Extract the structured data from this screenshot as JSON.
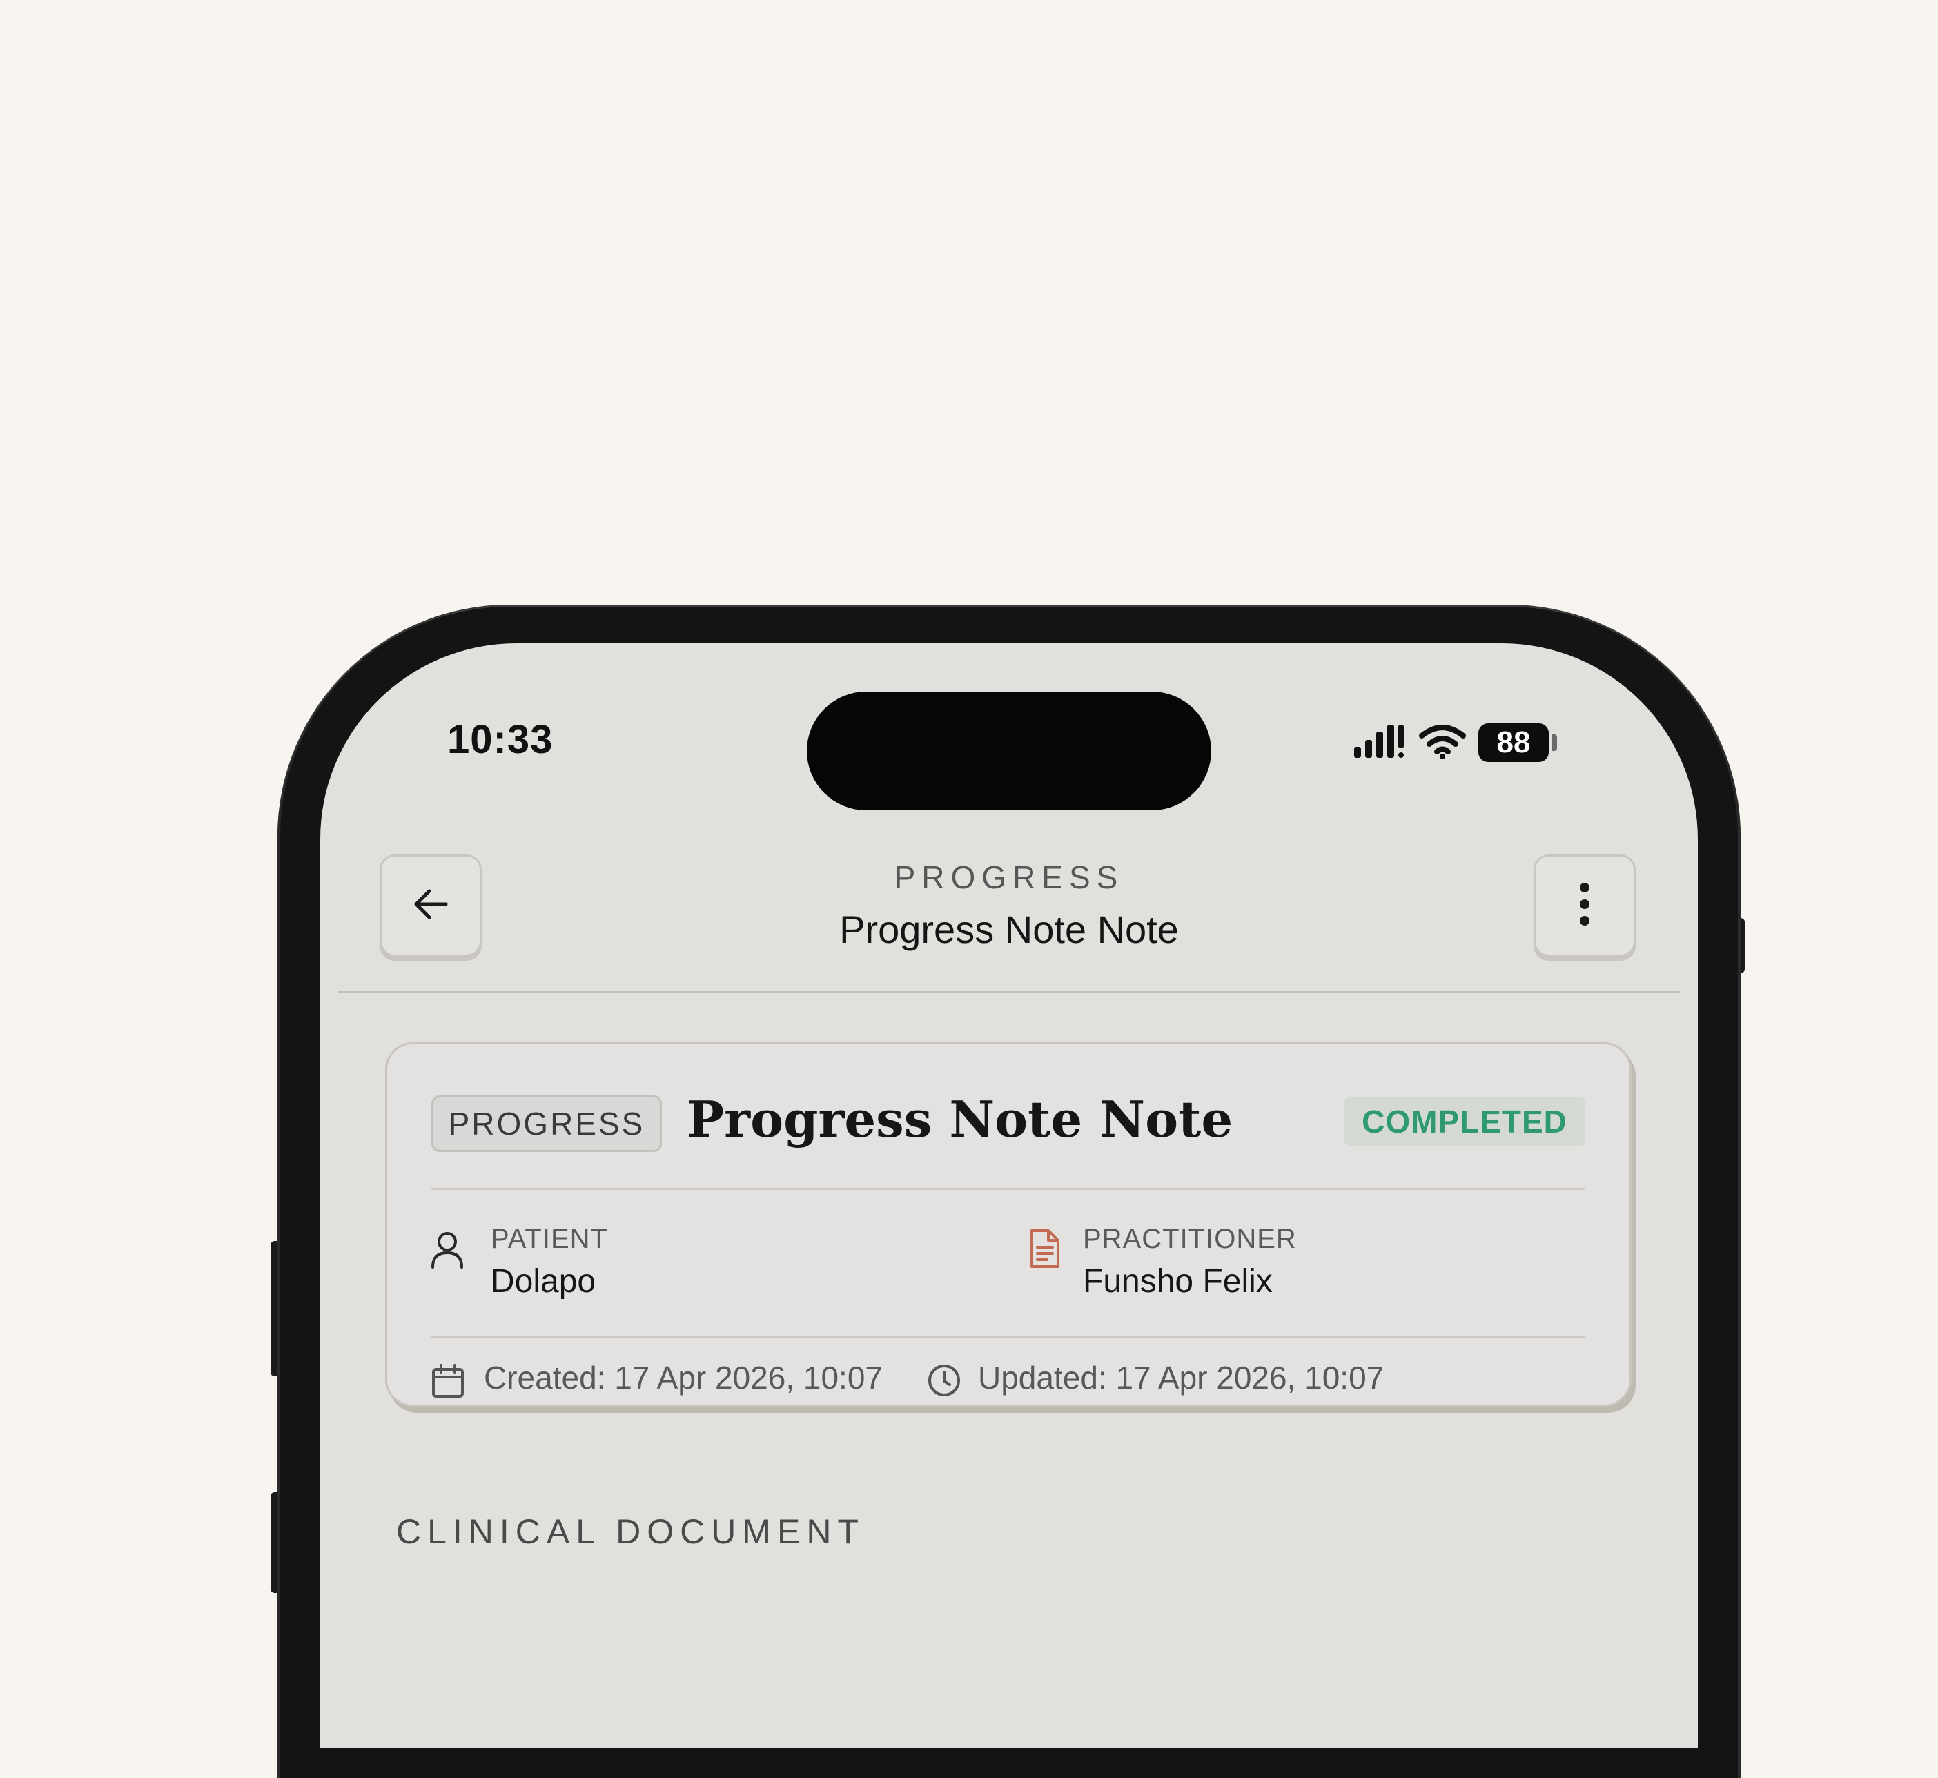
{
  "status_bar": {
    "time": "10:33",
    "battery": "88"
  },
  "header": {
    "overline": "PROGRESS",
    "title": "Progress Note Note"
  },
  "note": {
    "type_badge": "PROGRESS",
    "title": "Progress Note Note",
    "status": "COMPLETED",
    "patient_label": "PATIENT",
    "patient_name": "Dolapo",
    "practitioner_label": "PRACTITIONER",
    "practitioner_name": "Funsho Felix",
    "created": "Created: 17 Apr 2026, 10:07",
    "updated": "Updated: 17 Apr 2026, 10:07"
  },
  "section_heading": "CLINICAL DOCUMENT",
  "colors": {
    "background": "#f8f5f1",
    "screen": "#e2e0dc",
    "status_completed": "#2f9a70",
    "practitioner_icon": "#c26a52"
  },
  "icons": {
    "back": "arrow-left-icon",
    "more": "more-vertical-icon",
    "patient": "user-icon",
    "practitioner": "document-icon",
    "created": "calendar-icon",
    "updated": "clock-icon"
  }
}
